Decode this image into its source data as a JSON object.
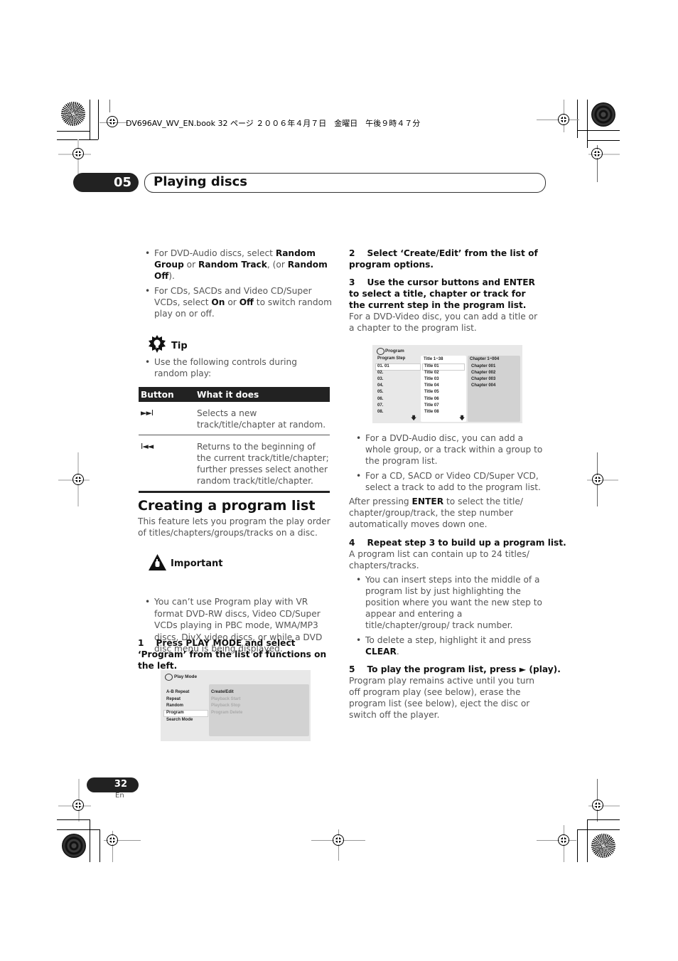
{
  "header_meta": "DV696AV_WV_EN.book  32 ページ  ２００６年４月７日　金曜日　午後９時４７分",
  "chapter": {
    "number": "05",
    "title": "Playing discs"
  },
  "left_column": {
    "bullets_top": [
      {
        "parts": [
          [
            "For DVD-Audio discs, select ",
            false
          ],
          [
            "Random Group",
            true
          ],
          [
            " or ",
            false
          ],
          [
            "Random Track",
            true
          ],
          [
            ", (or ",
            false
          ],
          [
            "Random Off",
            true
          ],
          [
            ").",
            false
          ]
        ]
      },
      {
        "parts": [
          [
            "For CDs, SACDs and Video CD/Super VCDs, select ",
            false
          ],
          [
            "On",
            true
          ],
          [
            " or ",
            false
          ],
          [
            "Off",
            true
          ],
          [
            " to switch random play on or off.",
            false
          ]
        ]
      }
    ],
    "tip": {
      "icon": "lightbulb-icon",
      "label": "Tip",
      "bullet": "Use the following controls during random play:"
    },
    "table": {
      "headers": [
        "Button",
        "What it does"
      ],
      "rows": [
        {
          "button": "►►I",
          "button_icon": "next-track-icon",
          "description": "Selects a new track/title/chapter at random."
        },
        {
          "button": "I◄◄",
          "button_icon": "previous-track-icon",
          "description": "Returns to the beginning of the current track/title/chapter; further presses select another random track/title/chapter."
        }
      ]
    },
    "section_title": "Creating a program list",
    "section_intro": "This feature lets you program the play order of titles/chapters/groups/tracks on a disc.",
    "important": {
      "icon": "warning-icon",
      "label": "Important",
      "bullet": "You can’t use Program play with VR format DVD-RW discs, Video CD/Super VCDs playing in PBC mode, WMA/MP3 discs, DivX video discs, or while a DVD disc menu is being displayed."
    },
    "step1": "1    Press PLAY MODE and select ‘Program’ from the list of functions on the left.",
    "play_mode_screen": {
      "title": "Play Mode",
      "menu": [
        "A-B Repeat",
        "Repeat",
        "Random",
        "Program",
        "Search Mode"
      ],
      "selected": "Program",
      "options": [
        {
          "label": "Create/Edit",
          "enabled": true
        },
        {
          "label": "Playback Start",
          "enabled": false
        },
        {
          "label": "Playback Stop",
          "enabled": false
        },
        {
          "label": "Program Delete",
          "enabled": false
        }
      ]
    }
  },
  "right_column": {
    "step2": "2    Select ‘Create/Edit’ from the list of program options.",
    "step3": "3    Use the cursor buttons and ENTER to select a title, chapter or track for the current step in the program list.",
    "step3_body": "For a DVD-Video disc, you can add a title or a chapter to the program list.",
    "program_screen": {
      "title": "Program",
      "col1_header": "Program Step",
      "col2_header": "Title 1~38",
      "col3_header": "Chapter 1~004",
      "steps": [
        "01. 01",
        "02.",
        "03.",
        "04.",
        "05.",
        "06.",
        "07.",
        "08."
      ],
      "titles": [
        "Title 01",
        "Title 02",
        "Title 03",
        "Title 04",
        "Title 05",
        "Title 06",
        "Title 07",
        "Title 08"
      ],
      "chapters": [
        "Chapter 001",
        "Chapter 002",
        "Chapter 003",
        "Chapter 004"
      ],
      "scroll_arrow": "🡇"
    },
    "bullets_mid": [
      "For a DVD-Audio disc, you can add a whole group, or a track within a group to the program list.",
      "For a CD, SACD or Video CD/Super VCD, select a track to add to the program list."
    ],
    "after_enter": [
      [
        "After pressing ",
        false
      ],
      [
        "ENTER",
        true
      ],
      [
        " to select the title/ chapter/group/track, the step number automatically moves down one.",
        false
      ]
    ],
    "step4": "4    Repeat step 3 to build up a program list.",
    "step4_body": "A program list can contain up to 24 titles/ chapters/tracks.",
    "bullets_bottom": [
      [
        [
          "You can insert steps into the middle of a program list by just highlighting the position where you want the new step to appear and entering a title/chapter/group/ track number.",
          false
        ]
      ],
      [
        [
          "To delete a step, highlight it and press ",
          false
        ],
        [
          "CLEAR",
          true
        ],
        [
          ".",
          false
        ]
      ]
    ],
    "step5": "5    To play the program list, press ► (play).",
    "step5_body": "Program play remains active until you turn off program play (see below), erase the program list (see below), eject the disc or switch off the player."
  },
  "footer": {
    "page_number": "32",
    "language": "En"
  }
}
